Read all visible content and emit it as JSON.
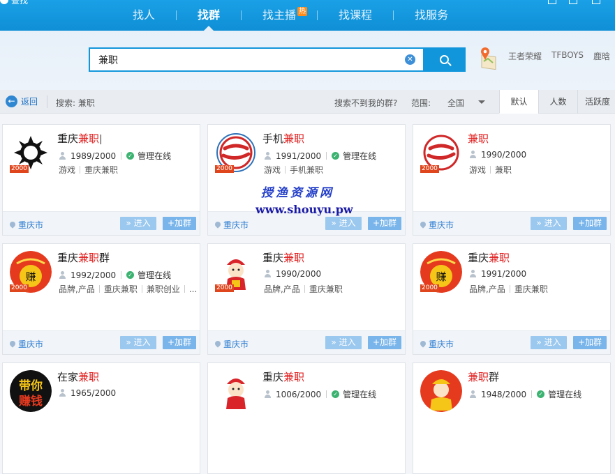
{
  "app": {
    "title": "查找"
  },
  "nav": {
    "items": [
      {
        "label": "找人"
      },
      {
        "label": "找群"
      },
      {
        "label": "找主播",
        "badge": "热"
      },
      {
        "label": "找课程"
      },
      {
        "label": "找服务"
      }
    ]
  },
  "search": {
    "value": "兼职",
    "hot_words": [
      "王者荣耀",
      "TFBOYS",
      "鹿晗"
    ]
  },
  "toolbar": {
    "back": "返回",
    "search_label": "搜索: 兼职",
    "not_found": "搜索不到我的群?",
    "range_label": "范围:",
    "range_value": "全国",
    "sort_tabs": [
      "默认",
      "人数",
      "活跃度"
    ]
  },
  "cards": [
    {
      "name_prefix": "重庆",
      "name_hl": "兼职",
      "name_suffix": "",
      "members": "1989/2000",
      "admin": "管理在线",
      "tags": [
        "游戏",
        "重庆兼职"
      ],
      "city": "重庆市",
      "badge": "2000",
      "enter": "» 进入",
      "join": "+加群"
    },
    {
      "name_prefix": "手机",
      "name_hl": "兼职",
      "name_suffix": "",
      "members": "1991/2000",
      "admin": "管理在线",
      "tags": [
        "游戏",
        "手机兼职"
      ],
      "city": "重庆市",
      "badge": "2000",
      "enter": "» 进入",
      "join": "+加群"
    },
    {
      "name_prefix": "",
      "name_hl": "兼职",
      "name_suffix": "",
      "members": "1990/2000",
      "admin": "",
      "tags": [
        "游戏",
        "兼职"
      ],
      "city": "重庆市",
      "badge": "2000",
      "enter": "» 进入",
      "join": "+加群"
    },
    {
      "name_prefix": "重庆",
      "name_hl": "兼职",
      "name_suffix": "群",
      "members": "1992/2000",
      "admin": "管理在线",
      "tags": [
        "品牌,产品",
        "重庆兼职",
        "兼职创业",
        "..."
      ],
      "city": "重庆市",
      "badge": "2000",
      "enter": "» 进入",
      "join": "+加群"
    },
    {
      "name_prefix": "重庆",
      "name_hl": "兼职",
      "name_suffix": "",
      "members": "1990/2000",
      "admin": "",
      "tags": [
        "品牌,产品",
        "重庆兼职"
      ],
      "city": "重庆市",
      "badge": "2000",
      "enter": "» 进入",
      "join": "+加群"
    },
    {
      "name_prefix": "重庆",
      "name_hl": "兼职",
      "name_suffix": "",
      "members": "1991/2000",
      "admin": "",
      "tags": [
        "品牌,产品",
        "重庆兼职"
      ],
      "city": "重庆市",
      "badge": "2000",
      "enter": "» 进入",
      "join": "+加群"
    },
    {
      "name_prefix": "在家",
      "name_hl": "兼职",
      "name_suffix": "",
      "members": "1965/2000",
      "admin": "",
      "tags": [],
      "city": "",
      "badge": "",
      "enter": "",
      "join": ""
    },
    {
      "name_prefix": "重庆",
      "name_hl": "兼职",
      "name_suffix": "",
      "members": "1006/2000",
      "admin": "管理在线",
      "tags": [],
      "city": "",
      "badge": "",
      "enter": "",
      "join": ""
    },
    {
      "name_prefix": "",
      "name_hl": "兼职",
      "name_suffix": "群",
      "members": "1948/2000",
      "admin": "管理在线",
      "tags": [],
      "city": "",
      "badge": "",
      "enter": "",
      "join": ""
    }
  ],
  "avatar_text": {
    "zhuan": "赚",
    "daini_1": "带你",
    "daini_2": "赚钱"
  },
  "watermark": {
    "line1": "授渔资源网",
    "line2": "www.shouyu.pw"
  },
  "colors": {
    "primary": "#1296db",
    "highlight": "#e02020",
    "link": "#2d7dd2"
  }
}
